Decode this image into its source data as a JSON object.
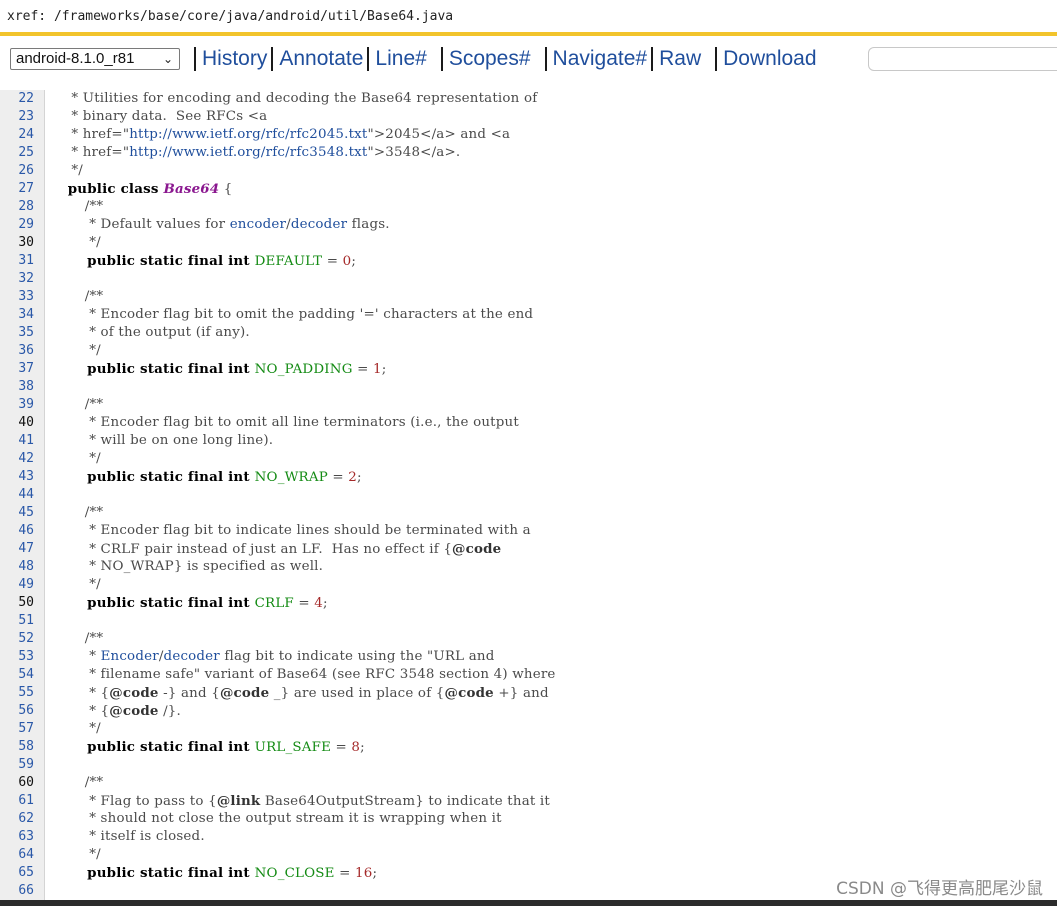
{
  "xref": {
    "path": "xref: /frameworks/base/core/java/android/util/Base64.java"
  },
  "nav": {
    "version": "android-8.1.0_r81",
    "links": [
      "History",
      "Annotate",
      "Line#",
      "Scopes#",
      "Navigate#",
      "Raw",
      "Download"
    ],
    "search_placeholder": ""
  },
  "colors": {
    "accent_bar": "#f2c42c",
    "link": "#1f4e9c",
    "keyword": "#000000",
    "class_name": "#8a178f",
    "constant": "#148b14",
    "number": "#a52a2a"
  },
  "code": {
    "lines": [
      {
        "n": "22",
        "dark": false,
        "parts": [
          [
            "",
            "   * Utilities for encoding and decoding the Base64 representation of"
          ]
        ]
      },
      {
        "n": "23",
        "dark": false,
        "parts": [
          [
            "",
            "   * binary data.  See RFCs <a"
          ]
        ]
      },
      {
        "n": "24",
        "dark": false,
        "parts": [
          [
            "",
            "   * href=\""
          ],
          [
            "lnk",
            "http://www.ietf.org/rfc/rfc2045.txt"
          ],
          [
            "",
            "\">2045</a> and <a"
          ]
        ]
      },
      {
        "n": "25",
        "dark": false,
        "parts": [
          [
            "",
            "   * href=\""
          ],
          [
            "lnk",
            "http://www.ietf.org/rfc/rfc3548.txt"
          ],
          [
            "",
            "\">3548</a>."
          ]
        ]
      },
      {
        "n": "26",
        "dark": false,
        "parts": [
          [
            "",
            "   */"
          ]
        ]
      },
      {
        "n": "27",
        "dark": false,
        "parts": [
          [
            "kw",
            "  public class "
          ],
          [
            "cls",
            "Base64"
          ],
          [
            "",
            " {"
          ]
        ]
      },
      {
        "n": "28",
        "dark": false,
        "parts": [
          [
            "",
            "      /**"
          ]
        ]
      },
      {
        "n": "29",
        "dark": false,
        "parts": [
          [
            "",
            "       * Default values for "
          ],
          [
            "lnk",
            "encoder"
          ],
          [
            "",
            "/"
          ],
          [
            "lnk",
            "decoder"
          ],
          [
            "",
            " flags."
          ]
        ]
      },
      {
        "n": "30",
        "dark": true,
        "parts": [
          [
            "",
            "       */"
          ]
        ]
      },
      {
        "n": "31",
        "dark": false,
        "parts": [
          [
            "kw",
            "      public static final int "
          ],
          [
            "const",
            "DEFAULT"
          ],
          [
            "",
            " = "
          ],
          [
            "num",
            "0"
          ],
          [
            "",
            ";"
          ]
        ]
      },
      {
        "n": "32",
        "dark": false,
        "parts": [
          [
            "",
            ""
          ]
        ]
      },
      {
        "n": "33",
        "dark": false,
        "parts": [
          [
            "",
            "      /**"
          ]
        ]
      },
      {
        "n": "34",
        "dark": false,
        "parts": [
          [
            "",
            "       * Encoder flag bit to omit the padding '=' characters at the end"
          ]
        ]
      },
      {
        "n": "35",
        "dark": false,
        "parts": [
          [
            "",
            "       * of the output (if any)."
          ]
        ]
      },
      {
        "n": "36",
        "dark": false,
        "parts": [
          [
            "",
            "       */"
          ]
        ]
      },
      {
        "n": "37",
        "dark": false,
        "parts": [
          [
            "kw",
            "      public static final int "
          ],
          [
            "const",
            "NO_PADDING"
          ],
          [
            "",
            " = "
          ],
          [
            "num",
            "1"
          ],
          [
            "",
            ";"
          ]
        ]
      },
      {
        "n": "38",
        "dark": false,
        "parts": [
          [
            "",
            ""
          ]
        ]
      },
      {
        "n": "39",
        "dark": false,
        "parts": [
          [
            "",
            "      /**"
          ]
        ]
      },
      {
        "n": "40",
        "dark": true,
        "parts": [
          [
            "",
            "       * Encoder flag bit to omit all line terminators (i.e., the output"
          ]
        ]
      },
      {
        "n": "41",
        "dark": false,
        "parts": [
          [
            "",
            "       * will be on one long line)."
          ]
        ]
      },
      {
        "n": "42",
        "dark": false,
        "parts": [
          [
            "",
            "       */"
          ]
        ]
      },
      {
        "n": "43",
        "dark": false,
        "parts": [
          [
            "kw",
            "      public static final int "
          ],
          [
            "const",
            "NO_WRAP"
          ],
          [
            "",
            " = "
          ],
          [
            "num",
            "2"
          ],
          [
            "",
            ";"
          ]
        ]
      },
      {
        "n": "44",
        "dark": false,
        "parts": [
          [
            "",
            ""
          ]
        ]
      },
      {
        "n": "45",
        "dark": false,
        "parts": [
          [
            "",
            "      /**"
          ]
        ]
      },
      {
        "n": "46",
        "dark": false,
        "parts": [
          [
            "",
            "       * Encoder flag bit to indicate lines should be terminated with a"
          ]
        ]
      },
      {
        "n": "47",
        "dark": false,
        "parts": [
          [
            "",
            "       * CRLF pair instead of just an LF.  Has no effect if {"
          ],
          [
            "tag",
            "@code"
          ]
        ]
      },
      {
        "n": "48",
        "dark": false,
        "parts": [
          [
            "",
            "       * NO_WRAP} is specified as well."
          ]
        ]
      },
      {
        "n": "49",
        "dark": false,
        "parts": [
          [
            "",
            "       */"
          ]
        ]
      },
      {
        "n": "50",
        "dark": true,
        "parts": [
          [
            "kw",
            "      public static final int "
          ],
          [
            "const",
            "CRLF"
          ],
          [
            "",
            " = "
          ],
          [
            "num",
            "4"
          ],
          [
            "",
            ";"
          ]
        ]
      },
      {
        "n": "51",
        "dark": false,
        "parts": [
          [
            "",
            ""
          ]
        ]
      },
      {
        "n": "52",
        "dark": false,
        "parts": [
          [
            "",
            "      /**"
          ]
        ]
      },
      {
        "n": "53",
        "dark": false,
        "parts": [
          [
            "",
            "       * "
          ],
          [
            "lnk",
            "Encoder"
          ],
          [
            "",
            "/"
          ],
          [
            "lnk",
            "decoder"
          ],
          [
            "",
            " flag bit to indicate using the \"URL and"
          ]
        ]
      },
      {
        "n": "54",
        "dark": false,
        "parts": [
          [
            "",
            "       * filename safe\" variant of Base64 (see RFC 3548 section 4) where"
          ]
        ]
      },
      {
        "n": "55",
        "dark": false,
        "parts": [
          [
            "",
            "       * {"
          ],
          [
            "tag",
            "@code"
          ],
          [
            "",
            " -} and {"
          ],
          [
            "tag",
            "@code"
          ],
          [
            "",
            " _} are used in place of {"
          ],
          [
            "tag",
            "@code"
          ],
          [
            "",
            " +} and"
          ]
        ]
      },
      {
        "n": "56",
        "dark": false,
        "parts": [
          [
            "",
            "       * {"
          ],
          [
            "tag",
            "@code"
          ],
          [
            "",
            " /}."
          ]
        ]
      },
      {
        "n": "57",
        "dark": false,
        "parts": [
          [
            "",
            "       */"
          ]
        ]
      },
      {
        "n": "58",
        "dark": false,
        "parts": [
          [
            "kw",
            "      public static final int "
          ],
          [
            "const",
            "URL_SAFE"
          ],
          [
            "",
            " = "
          ],
          [
            "num",
            "8"
          ],
          [
            "",
            ";"
          ]
        ]
      },
      {
        "n": "59",
        "dark": false,
        "parts": [
          [
            "",
            ""
          ]
        ]
      },
      {
        "n": "60",
        "dark": true,
        "parts": [
          [
            "",
            "      /**"
          ]
        ]
      },
      {
        "n": "61",
        "dark": false,
        "parts": [
          [
            "",
            "       * Flag to pass to {"
          ],
          [
            "tag",
            "@link"
          ],
          [
            "",
            " Base64OutputStream} to indicate that it"
          ]
        ]
      },
      {
        "n": "62",
        "dark": false,
        "parts": [
          [
            "",
            "       * should not close the output stream it is wrapping when it"
          ]
        ]
      },
      {
        "n": "63",
        "dark": false,
        "parts": [
          [
            "",
            "       * itself is closed."
          ]
        ]
      },
      {
        "n": "64",
        "dark": false,
        "parts": [
          [
            "",
            "       */"
          ]
        ]
      },
      {
        "n": "65",
        "dark": false,
        "parts": [
          [
            "kw",
            "      public static final int "
          ],
          [
            "const",
            "NO_CLOSE"
          ],
          [
            "",
            " = "
          ],
          [
            "num",
            "16"
          ],
          [
            "",
            ";"
          ]
        ]
      },
      {
        "n": "66",
        "dark": false,
        "parts": [
          [
            "",
            ""
          ]
        ]
      }
    ]
  },
  "watermark": "CSDN @飞得更高肥尾沙鼠"
}
